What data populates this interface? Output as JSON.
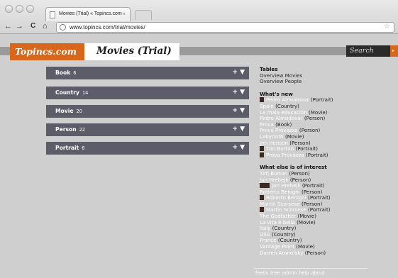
{
  "browser": {
    "tab_title": "Movies (Trial) « Topincs.com",
    "tab_close": "×",
    "back": "←",
    "forward": "→",
    "reload": "C",
    "home": "⌂",
    "url": "www.topincs.com/trial/movies/",
    "bookmark": "☆"
  },
  "header": {
    "logo": "Topincs.com",
    "title": "Movies (Trial)",
    "search": "Search",
    "search_button": "▸"
  },
  "tables": [
    {
      "label": "Book",
      "count": "6",
      "controls": "+ ▼"
    },
    {
      "label": "Country",
      "count": "14",
      "controls": "+ ▼"
    },
    {
      "label": "Movie",
      "count": "20",
      "controls": "+ ▼"
    },
    {
      "label": "Person",
      "count": "22",
      "controls": "+ ▼"
    },
    {
      "label": "Portrait",
      "count": "6",
      "controls": "+ ▼"
    }
  ],
  "sidebar": {
    "tables_heading": "Tables",
    "tables_links": [
      "Overview Movies",
      "Overview People"
    ],
    "whats_new_heading": "What's new",
    "whats_new": [
      {
        "name": "Pedro Almodovar",
        "type": "(Portrait)",
        "thumb": true
      },
      {
        "name": "Spain",
        "type": "(Country)"
      },
      {
        "name": "La mala educación",
        "type": "(Movie)"
      },
      {
        "name": "Pedro Almodovar",
        "type": "(Person)"
      },
      {
        "name": "Prova",
        "type": "(Book)"
      },
      {
        "name": "Prova Provazza",
        "type": "(Person)"
      },
      {
        "name": "Labyrinth",
        "type": "(Movie)"
      },
      {
        "name": "Jim Henson",
        "type": "(Person)"
      },
      {
        "name": "Tim Burton",
        "type": "(Portrait)",
        "thumb": true
      },
      {
        "name": "Prova Provazza",
        "type": "(Portrait)",
        "thumb": true
      }
    ],
    "interest_heading": "What else is of interest",
    "interest": [
      {
        "name": "Tim Burton",
        "type": "(Person)"
      },
      {
        "name": "Jan Hrebejk",
        "type": "(Person)"
      },
      {
        "name": "Jan Hrebejk",
        "type": "(Portrait)",
        "thumb": true,
        "wide": true
      },
      {
        "name": "Roberto Benigni",
        "type": "(Person)"
      },
      {
        "name": "Roberto Benigni",
        "type": "(Portrait)",
        "thumb": true
      },
      {
        "name": "Martin Scorsese",
        "type": "(Person)"
      },
      {
        "name": "Martin Scorsese",
        "type": "(Portrait)",
        "thumb": true
      },
      {
        "name": "The Godfather",
        "type": "(Movie)"
      },
      {
        "name": "La vita è bella",
        "type": "(Movie)"
      },
      {
        "name": "Italy",
        "type": "(Country)"
      },
      {
        "name": "USA",
        "type": "(Country)"
      },
      {
        "name": "France",
        "type": "(Country)"
      },
      {
        "name": "Vantage Point",
        "type": "(Movie)"
      },
      {
        "name": "Darren Aronofsky",
        "type": "(Person)"
      }
    ],
    "footer_links": [
      "feeds",
      "tree",
      "admin",
      "help",
      "about"
    ]
  }
}
